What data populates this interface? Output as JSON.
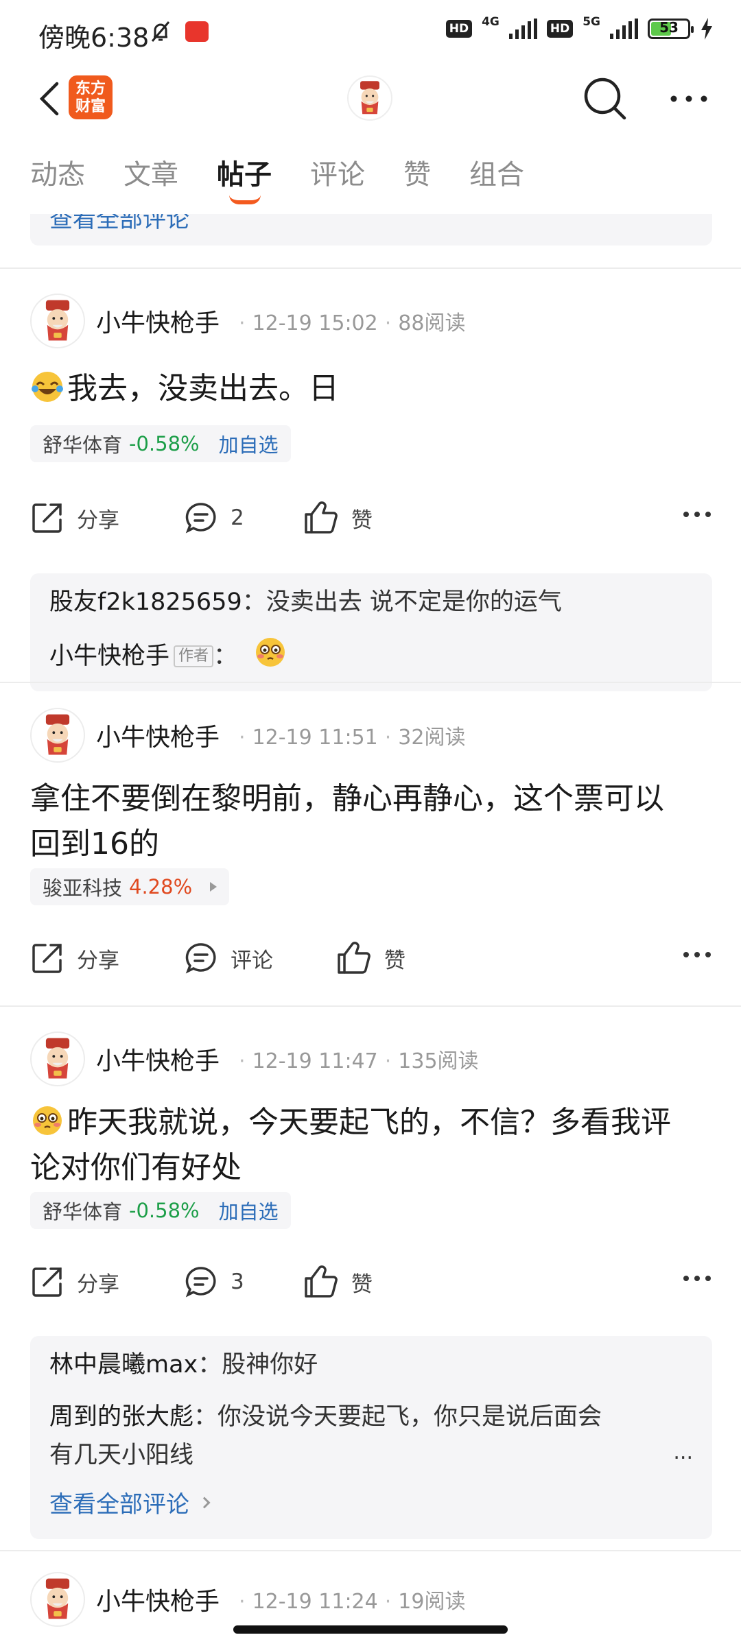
{
  "status_bar": {
    "time": "傍晚6:38",
    "network_1": "4G",
    "network_2": "5G",
    "hd_label": "HD",
    "battery": "53"
  },
  "header": {
    "logo_text_line1": "东方",
    "logo_text_line2": "财富"
  },
  "tabs": [
    {
      "label": "动态"
    },
    {
      "label": "文章"
    },
    {
      "label": "帖子",
      "active": true
    },
    {
      "label": "评论"
    },
    {
      "label": "赞"
    },
    {
      "label": "组合"
    }
  ],
  "partial_prev": {
    "view_all": "查看全部评论"
  },
  "posts": [
    {
      "author": "小牛快枪手",
      "time": "12-19 15:02",
      "reads": "88阅读",
      "emoji": "laugh-cry",
      "text": "我去，没卖出去。日",
      "stock": {
        "name": "舒华体育",
        "change": "-0.58%",
        "direction": "down",
        "add_label": "加自选"
      },
      "actions": {
        "share": "分享",
        "comment": "2",
        "like": "赞"
      },
      "comments": [
        {
          "user": "股友f2k1825659",
          "sep": "：",
          "text": "没卖出去 说不定是你的运气"
        },
        {
          "user": "小牛快枪手",
          "badge": "作者",
          "sep": "：",
          "emoji": "blushing-face"
        }
      ]
    },
    {
      "author": "小牛快枪手",
      "time": "12-19 11:51",
      "reads": "32阅读",
      "text_line1": "拿住不要倒在黎明前，静心再静心，这个票可以",
      "text_line2": "回到16的",
      "stock": {
        "name": "骏亚科技",
        "change": "4.28%",
        "direction": "up"
      },
      "actions": {
        "share": "分享",
        "comment": "评论",
        "like": "赞"
      }
    },
    {
      "author": "小牛快枪手",
      "time": "12-19 11:47",
      "reads": "135阅读",
      "emoji": "blushing-face",
      "text_line1": "昨天我就说，今天要起飞的，不信？多看我评",
      "text_line2": "论对你们有好处",
      "stock": {
        "name": "舒华体育",
        "change": "-0.58%",
        "direction": "down",
        "add_label": "加自选"
      },
      "actions": {
        "share": "分享",
        "comment": "3",
        "like": "赞"
      },
      "comments": [
        {
          "user": "林中晨曦max",
          "sep": "：",
          "text": "股神你好"
        },
        {
          "user": "周到的张大彪",
          "sep": "：",
          "text_line1": "你没说今天要起飞，你只是说后面会",
          "text_line2": "有几天小阳线"
        }
      ],
      "ellipsis": "...",
      "view_all": "查看全部评论"
    },
    {
      "author": "小牛快枪手",
      "time": "12-19 11:24",
      "reads": "19阅读"
    }
  ],
  "colors": {
    "accent": "#f35a1f",
    "link": "#2c6db8",
    "down": "#1c9e48",
    "up": "#e0491f"
  }
}
